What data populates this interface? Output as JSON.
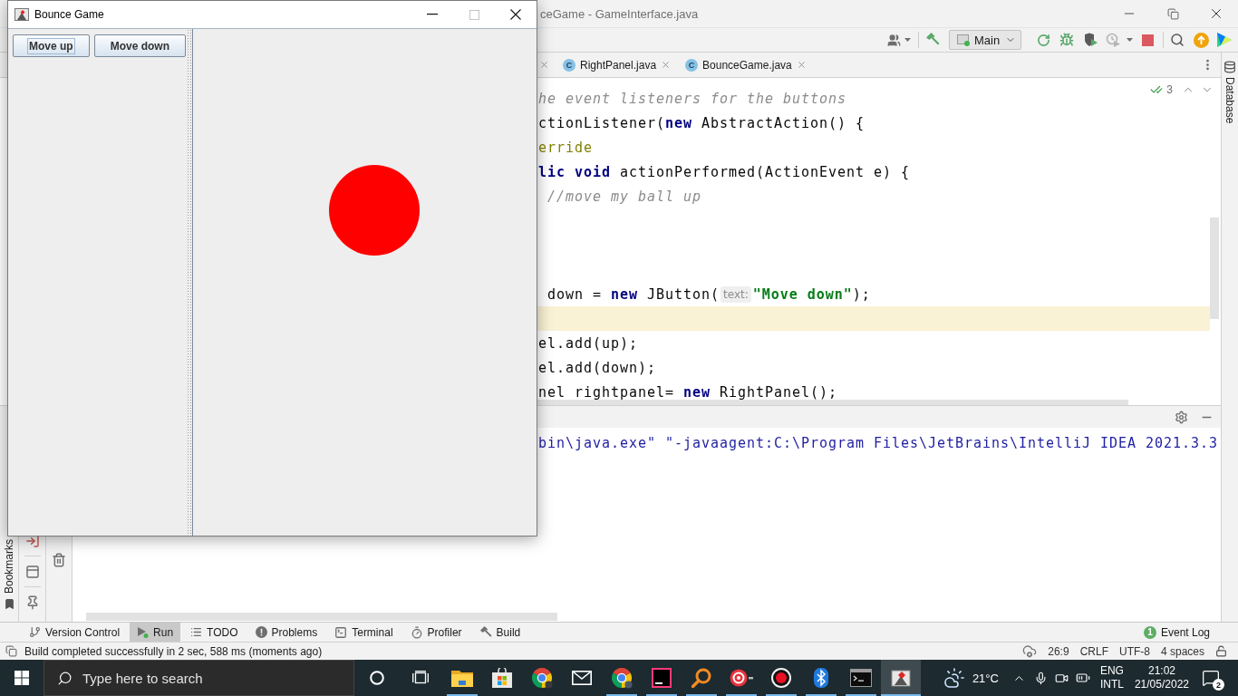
{
  "ide": {
    "title": "ceGame - GameInterface.java",
    "run_configuration": "Main",
    "toolbar_actions": [
      {
        "kind": "rerun",
        "disabled": false
      },
      {
        "kind": "debug",
        "disabled": false
      },
      {
        "kind": "coverage",
        "disabled": false
      },
      {
        "kind": "profile",
        "disabled": true
      },
      {
        "kind": "stop",
        "disabled": false
      }
    ],
    "editor_tabs": [
      {
        "badge": "C",
        "label": "RightPanel.java",
        "selected": false
      },
      {
        "badge": "C",
        "label": "BounceGame.java",
        "selected": false
      }
    ],
    "inspections": "3",
    "code_lines": [
      {
        "kind": "code",
        "current": false,
        "tokens": [
          {
            "kind": "comment",
            "text": "he event listeners for the buttons"
          }
        ]
      },
      {
        "kind": "code",
        "current": false,
        "tokens": [
          {
            "kind": "plain",
            "text": "ctionListener("
          },
          {
            "kind": "keyword",
            "text": "new"
          },
          {
            "kind": "plain",
            "text": " AbstractAction() {"
          }
        ]
      },
      {
        "kind": "code",
        "current": false,
        "tokens": [
          {
            "kind": "annotation",
            "text": "erride"
          }
        ]
      },
      {
        "kind": "code",
        "current": false,
        "tokens": [
          {
            "kind": "keyword",
            "text": "lic void"
          },
          {
            "kind": "plain",
            "text": " actionPerformed(ActionEvent e) {"
          }
        ]
      },
      {
        "kind": "code",
        "current": false,
        "tokens": [
          {
            "kind": "comment",
            "text": " //move my ball up"
          }
        ]
      },
      {
        "kind": "blank",
        "current": false
      },
      {
        "kind": "blank",
        "current": false
      },
      {
        "kind": "blank",
        "current": false
      },
      {
        "kind": "code",
        "current": false,
        "tokens": [
          {
            "kind": "plain",
            "text": " down = "
          },
          {
            "kind": "keyword",
            "text": "new"
          },
          {
            "kind": "plain",
            "text": " JButton("
          },
          {
            "kind": "hint",
            "text": "text:"
          },
          {
            "kind": "string",
            "text": "\"Move down\""
          },
          {
            "kind": "plain",
            "text": ");"
          }
        ]
      },
      {
        "kind": "blank",
        "current": true
      },
      {
        "kind": "code",
        "current": false,
        "tokens": [
          {
            "kind": "plain",
            "text": "el.add(up);"
          }
        ]
      },
      {
        "kind": "code",
        "current": false,
        "tokens": [
          {
            "kind": "plain",
            "text": "el.add(down);"
          }
        ]
      },
      {
        "kind": "code",
        "current": false,
        "tokens": [
          {
            "kind": "plain",
            "text": "nel rightpanel= "
          },
          {
            "kind": "keyword",
            "text": "new"
          },
          {
            "kind": "plain",
            "text": " RightPanel();"
          }
        ]
      }
    ],
    "console_lines": [
      "bin\\java.exe\" \"-javaagent:C:\\Program Files\\JetBrains\\IntelliJ IDEA 2021.3.3"
    ],
    "left_strip_label": "Bookmarks",
    "right_strip_label": "Database",
    "tool_tabs": [
      {
        "label": "Version Control",
        "selected": false
      },
      {
        "label": "Run",
        "selected": true
      },
      {
        "label": "TODO",
        "selected": false
      },
      {
        "label": "Problems",
        "selected": false
      },
      {
        "label": "Terminal",
        "selected": false
      },
      {
        "label": "Profiler",
        "selected": false
      },
      {
        "label": "Build",
        "selected": false
      }
    ],
    "event_log": {
      "label": "Event Log",
      "badge": "1"
    },
    "status_bar": {
      "message": "Build completed successfully in 2 sec, 588 ms (moments ago)",
      "items": [
        "26:9",
        "CRLF",
        "UTF-8",
        "4 spaces"
      ]
    }
  },
  "game_window": {
    "title": "Bounce Game",
    "controls": [
      {
        "kind": "minimize",
        "disabled": false
      },
      {
        "kind": "maximize",
        "disabled": true
      },
      {
        "kind": "close",
        "disabled": false
      }
    ],
    "buttons": [
      {
        "label": "Move up",
        "focused": true
      },
      {
        "label": "Move down",
        "focused": false
      }
    ]
  },
  "taskbar": {
    "search": {
      "placeholder": "Type here to search"
    },
    "apps": [
      {
        "running": true,
        "selected": false
      },
      {
        "running": false,
        "selected": false
      },
      {
        "running": false,
        "selected": false
      },
      {
        "running": false,
        "selected": false
      },
      {
        "running": true,
        "selected": false
      },
      {
        "running": true,
        "selected": false
      },
      {
        "running": true,
        "selected": false
      },
      {
        "running": true,
        "selected": false
      },
      {
        "running": true,
        "selected": false
      },
      {
        "running": true,
        "selected": false
      },
      {
        "running": true,
        "selected": false
      },
      {
        "running": true,
        "selected": true
      }
    ],
    "weather": "21°C",
    "language": [
      "ENG",
      "INTL"
    ],
    "time": "21:02",
    "date": "21/05/2022",
    "notifications": "2"
  }
}
